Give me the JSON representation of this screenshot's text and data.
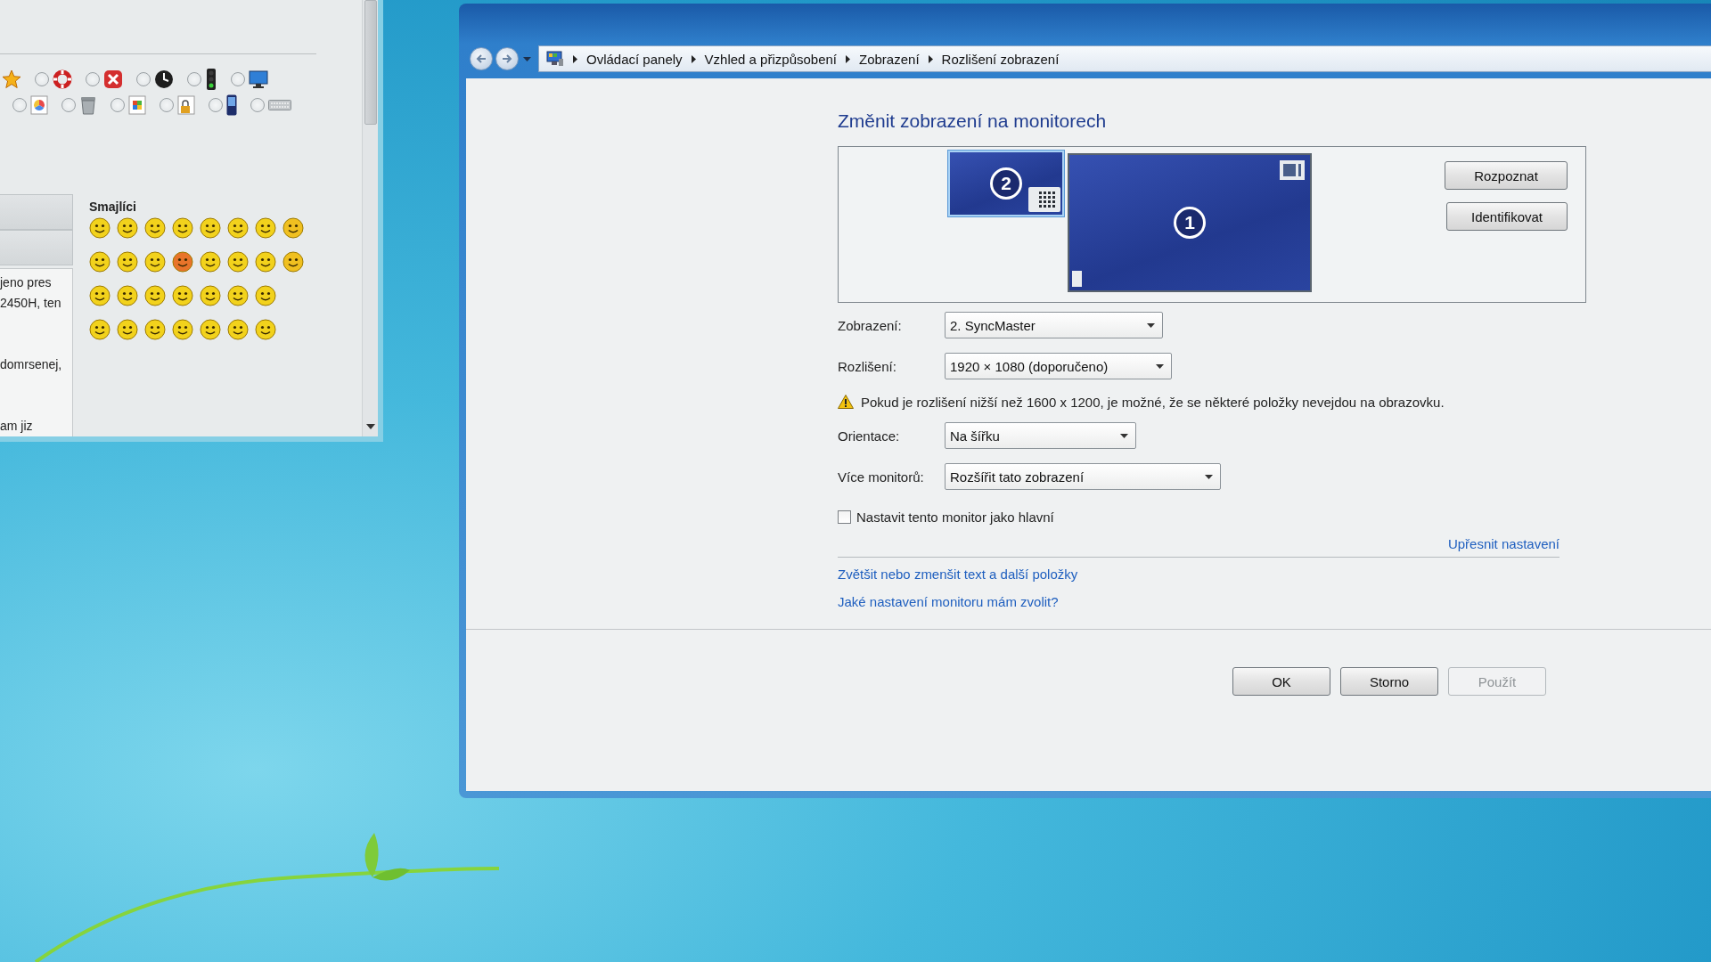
{
  "left_window": {
    "icon_option_rows": [
      [
        {
          "selected": false
        },
        {
          "selected": false
        },
        {
          "selected": false
        },
        {
          "selected": false
        },
        {
          "selected": false
        }
      ],
      [
        {
          "selected": false
        },
        {
          "selected": false
        },
        {
          "selected": false
        },
        {
          "selected": false
        },
        {
          "selected": false
        },
        {
          "selected": false
        }
      ]
    ],
    "text_paragraphs": [
      [
        "jeno pres",
        "2450H, ten"
      ],
      [
        "domrsenej,"
      ],
      [
        "am jiz"
      ]
    ],
    "smileys_title": "Smajlíci"
  },
  "window": {
    "breadcrumb": [
      "Ovládací panely",
      "Vzhled a přizpůsobení",
      "Zobrazení",
      "Rozlišení zobrazení"
    ],
    "heading": "Změnit zobrazení na monitorech",
    "monitors": [
      {
        "number": "2",
        "selected": true
      },
      {
        "number": "1",
        "selected": false
      }
    ],
    "monitor_buttons": [
      "Rozpoznat",
      "Identifikovat"
    ],
    "settings": [
      {
        "kind": "select",
        "label": "Zobrazení:",
        "value": "2. SyncMaster"
      },
      {
        "kind": "select",
        "label": "Rozlišení:",
        "value": "1920 × 1080 (doporučeno)"
      },
      {
        "kind": "warning",
        "text": "Pokud je rozlišení nižší než 1600 x 1200, je možné, že se některé položky nevejdou na obrazovku."
      },
      {
        "kind": "select",
        "label": "Orientace:",
        "value": "Na šířku"
      },
      {
        "kind": "select",
        "label": "Více monitorů:",
        "value": "Rozšířit tato zobrazení"
      }
    ],
    "primary_checkbox": {
      "label": "Nastavit tento monitor jako hlavní",
      "checked": false
    },
    "advanced_link": "Upřesnit nastavení",
    "links": [
      "Zvětšit nebo zmenšit text a další položky",
      "Jaké nastavení monitoru mám zvolit?"
    ],
    "buttons": [
      {
        "label": "OK",
        "disabled": false
      },
      {
        "label": "Storno",
        "disabled": false
      },
      {
        "label": "Použít",
        "disabled": true
      }
    ]
  }
}
